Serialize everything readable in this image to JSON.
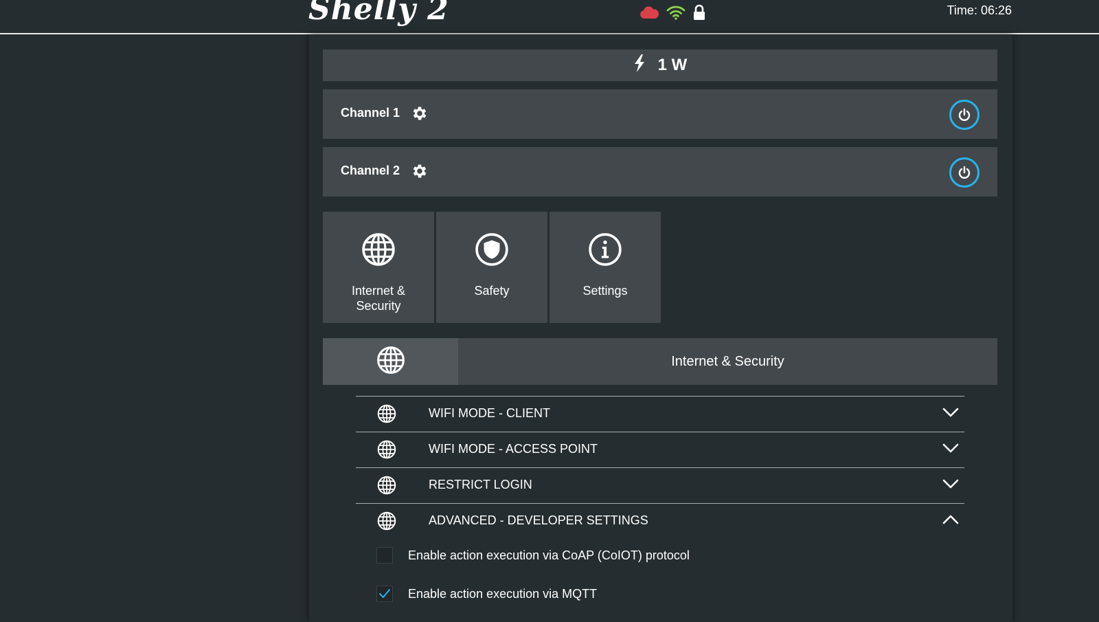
{
  "header": {
    "logo": "Shelly 2",
    "time": "Time: 06:26",
    "icons": [
      "cloud-icon",
      "wifi-icon",
      "lock-icon"
    ],
    "colors": {
      "cloud": "#d9414a",
      "wifi": "#8fd14f",
      "lock": "#ffffff"
    }
  },
  "power": {
    "value": "1 W",
    "icon": "lightning-icon"
  },
  "channels": [
    {
      "label": "Channel 1",
      "icon": "gear-icon",
      "toggle_icon": "power-icon"
    },
    {
      "label": "Channel 2",
      "icon": "gear-icon",
      "toggle_icon": "power-icon"
    }
  ],
  "tiles": [
    {
      "label": "Internet & Security",
      "icon": "globe-icon"
    },
    {
      "label": "Safety",
      "icon": "shield-icon"
    },
    {
      "label": "Settings",
      "icon": "info-icon"
    }
  ],
  "section": {
    "title": "Internet & Security",
    "icon": "globe-icon"
  },
  "accordion": [
    {
      "label": "WIFI MODE - CLIENT",
      "expanded": false
    },
    {
      "label": "WIFI MODE - ACCESS POINT",
      "expanded": false
    },
    {
      "label": "RESTRICT LOGIN",
      "expanded": false
    },
    {
      "label": "ADVANCED - DEVELOPER SETTINGS",
      "expanded": true
    }
  ],
  "options": [
    {
      "label": "Enable action execution via CoAP (CoIOT) protocol",
      "checked": false
    },
    {
      "label": "Enable action execution via MQTT",
      "checked": true
    }
  ],
  "colors": {
    "accent": "#29b3ea",
    "panel": "#42484c",
    "background": "#262d30"
  }
}
